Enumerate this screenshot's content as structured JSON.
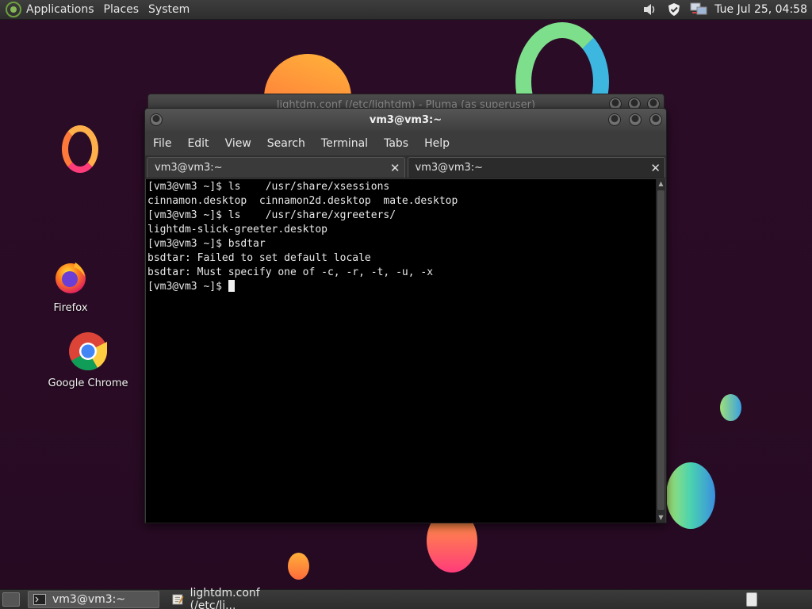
{
  "top_panel": {
    "menus": [
      "Applications",
      "Places",
      "System"
    ],
    "tray_icons": [
      "volume-icon",
      "shield-icon",
      "network-icon"
    ],
    "clock": "Tue Jul 25, 04:58"
  },
  "desktop_icons": [
    {
      "label": "Firefox",
      "icon": "firefox-icon"
    },
    {
      "label": "Google Chrome",
      "icon": "chrome-icon"
    }
  ],
  "background_window": {
    "title": "lightdm.conf (/etc/lightdm) - Pluma (as superuser)"
  },
  "terminal": {
    "title": "vm3@vm3:~",
    "menu": [
      "File",
      "Edit",
      "View",
      "Search",
      "Terminal",
      "Tabs",
      "Help"
    ],
    "tabs": [
      {
        "label": "vm3@vm3:~",
        "active": false
      },
      {
        "label": "vm3@vm3:~",
        "active": true
      }
    ],
    "lines": [
      "[vm3@vm3 ~]$ ls    /usr/share/xsessions",
      "cinnamon.desktop  cinnamon2d.desktop  mate.desktop",
      "[vm3@vm3 ~]$ ls    /usr/share/xgreeters/",
      "lightdm-slick-greeter.desktop",
      "[vm3@vm3 ~]$ bsdtar",
      "bsdtar: Failed to set default locale",
      "bsdtar: Must specify one of -c, -r, -t, -u, -x"
    ],
    "prompt": "[vm3@vm3 ~]$ "
  },
  "taskbar": {
    "tasks": [
      {
        "label": "vm3@vm3:~",
        "active": true,
        "icon": "terminal-icon"
      },
      {
        "label": "lightdm.conf (/etc/li...",
        "active": false,
        "icon": "text-editor-icon"
      }
    ]
  },
  "colors": {
    "desktop_bg": "#2a0b25",
    "panel_bg": "#333333",
    "terminal_bg": "#000000",
    "terminal_fg": "#e8e8e8"
  }
}
